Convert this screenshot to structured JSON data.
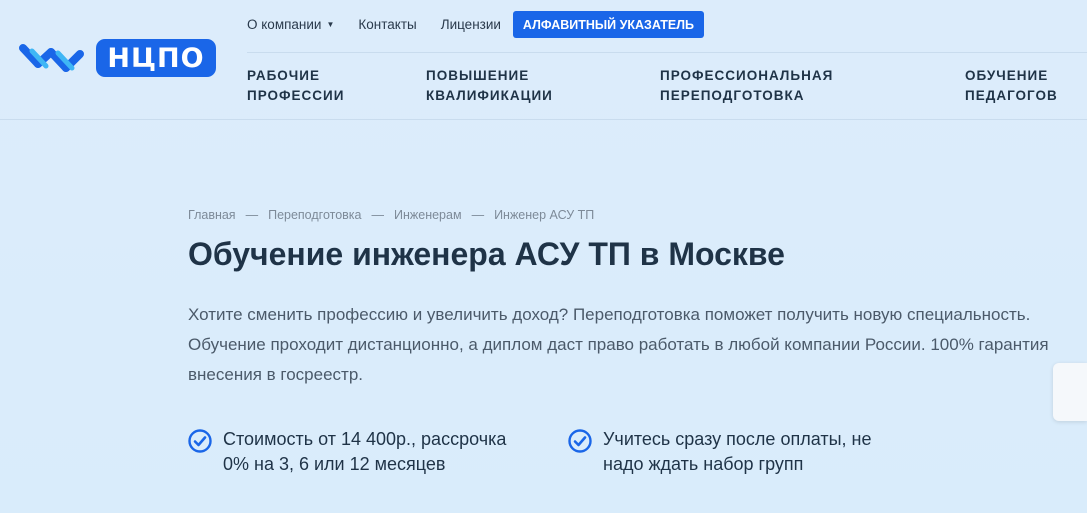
{
  "logo": {
    "text": "НЦПО"
  },
  "topnav": {
    "about": "О компании",
    "contacts": "Контакты",
    "licenses": "Лицензии",
    "alphabet": "АЛФАВИТНЫЙ УКАЗАТЕЛЬ"
  },
  "mainnav": {
    "items": [
      {
        "line1": "РАБОЧИЕ",
        "line2": "ПРОФЕССИИ"
      },
      {
        "line1": "ПОВЫШЕНИЕ",
        "line2": "КВАЛИФИКАЦИИ"
      },
      {
        "line1": "ПРОФЕССИОНАЛЬНАЯ",
        "line2": "ПЕРЕПОДГОТОВКА"
      },
      {
        "line1": "ОБУЧЕНИЕ",
        "line2": "ПЕДАГОГОВ"
      }
    ]
  },
  "breadcrumb": {
    "items": [
      "Главная",
      "Переподготовка",
      "Инженерам",
      "Инженер АСУ ТП"
    ],
    "separator": "—"
  },
  "page": {
    "title": "Обучение инженера АСУ ТП в Москве",
    "lead_line1": "Хотите сменить профессию и увеличить доход? Переподготовка поможет получить новую специальность.",
    "lead_line2": "Обучение проходит дистанционно, а диплом даст право работать в любой компании России. 100% гарантия",
    "lead_line3": "внесения в госреестр."
  },
  "features": [
    {
      "line1": "Стоимость от 14 400р., рассрочка",
      "line2": "0% на 3, 6 или 12 месяцев"
    },
    {
      "line1": "Учитесь сразу после оплаты, не",
      "line2": "надо ждать набор групп"
    }
  ],
  "colors": {
    "accent": "#1a66e8",
    "check": "#1a66e8"
  }
}
